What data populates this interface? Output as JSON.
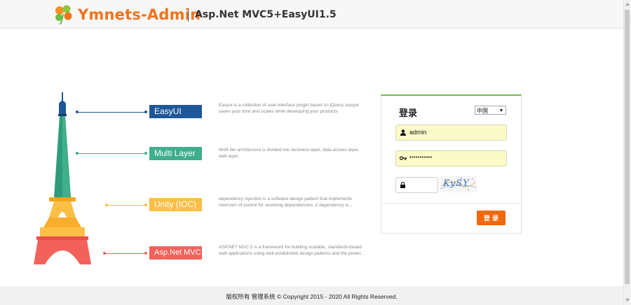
{
  "header": {
    "brand": "Ymnets-Admin",
    "subtitle": "Asp.Net MVC5+EasyUI1.5"
  },
  "features": [
    {
      "label": "EasyUI",
      "color": "#1d5799",
      "desc": "Easyui is a collection of user-interface plugin based on jQuery, easyui saves your time and scales while developing your products"
    },
    {
      "label": "Multi Layer",
      "color": "#3fae8c",
      "desc": "Multi tier architecture is divided into business layer, data access layer, web layer."
    },
    {
      "label": "Unity (IOC)",
      "color": "#fbbf46",
      "desc": "dependency injection is a software design pattern that implements inversion of control for resolving dependencies. A dependency is..."
    },
    {
      "label": "Asp.Net MVC",
      "color": "#f3625a",
      "desc": "ASP.NET MVC 5 is a framework for building scalable, standards-based web applications using well-established design patterns and the power..."
    }
  ],
  "login": {
    "title": "登录",
    "language": "中国",
    "username": "admin",
    "password": "•••••••••••",
    "code_value": "",
    "captcha": "KySY",
    "submit_label": "登 录",
    "accent_color": "#6cbd45",
    "button_color": "#f0690d"
  },
  "footer": {
    "text": "版权所有 管理系统 © Copyright 2015 - 2020 All Rights Reserved."
  }
}
